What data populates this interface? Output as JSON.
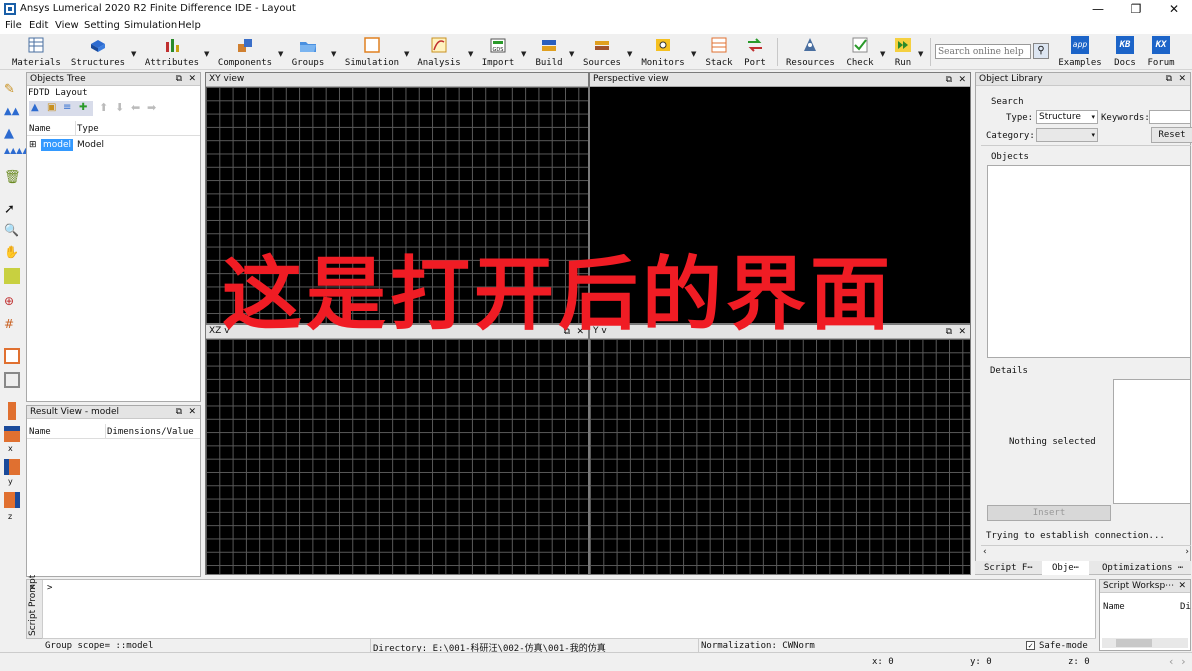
{
  "window": {
    "title": "Ansys Lumerical 2020 R2 Finite Difference IDE - Layout",
    "controls": {
      "minimize": "—",
      "maximize": "❐",
      "close": "✕"
    }
  },
  "menu": [
    "File",
    "Edit",
    "View",
    "Setting",
    "Simulation",
    "Help"
  ],
  "toolbar": {
    "items": [
      "Materials",
      "Structures",
      "Attributes",
      "Components",
      "Groups",
      "Simulation",
      "Analysis",
      "Import",
      "Build",
      "Sources",
      "Monitors",
      "Stack",
      "Port",
      "Resources",
      "Check",
      "Run",
      "Examples",
      "Docs",
      "Forum"
    ],
    "search_placeholder": "Search online help",
    "icon_letters": {
      "examples": "app",
      "docs": "KB",
      "forum": "KX",
      "import": "GDS"
    }
  },
  "objects_tree": {
    "title": "Objects Tree",
    "subtitle": "FDTD Layout",
    "col_name": "Name",
    "col_type": "Type",
    "row": {
      "name": "model",
      "type": "Model"
    }
  },
  "result_view": {
    "title": "Result View - model",
    "col_name": "Name",
    "col_value": "Dimensions/Value"
  },
  "views": {
    "xy": "XY view",
    "perspective": "Perspective view",
    "xz": "XZ v",
    "yz": "Y v"
  },
  "overlay_text": "这是打开后的界面",
  "object_library": {
    "title": "Object Library",
    "search": "Search",
    "type_label": "Type:",
    "type_value": "Structure",
    "keywords_label": "Keywords:",
    "category_label": "Category:",
    "reset": "Reset",
    "objects": "Objects",
    "details": "Details",
    "nothing_selected": "Nothing selected",
    "insert": "Insert",
    "connection": "Trying to establish connection..."
  },
  "bottom_tabs": [
    "Script F⋯",
    "Obje⋯",
    "Optimizations ⋯"
  ],
  "script_prompt": {
    "title": "Script Prompt",
    "prompt": ">"
  },
  "script_workspace": {
    "title": "Script Worksp⋯",
    "col_name": "Name",
    "col_di": "Di"
  },
  "status": {
    "group_scope": "Group scope= ::model",
    "directory": "Directory: E:\\001-科研汪\\002-仿真\\001-我的仿真",
    "normalization": "Normalization: CWNorm",
    "safe_mode": "Safe-mode",
    "x": "x: 0",
    "y": "y: 0",
    "z": "z: 0"
  },
  "left_axis_labels": [
    "x",
    "y",
    "z"
  ],
  "colors": {
    "overlay": "#f01c24",
    "selection": "#3399ff",
    "viewport": "#000000",
    "grid": "#5a5a5a"
  }
}
